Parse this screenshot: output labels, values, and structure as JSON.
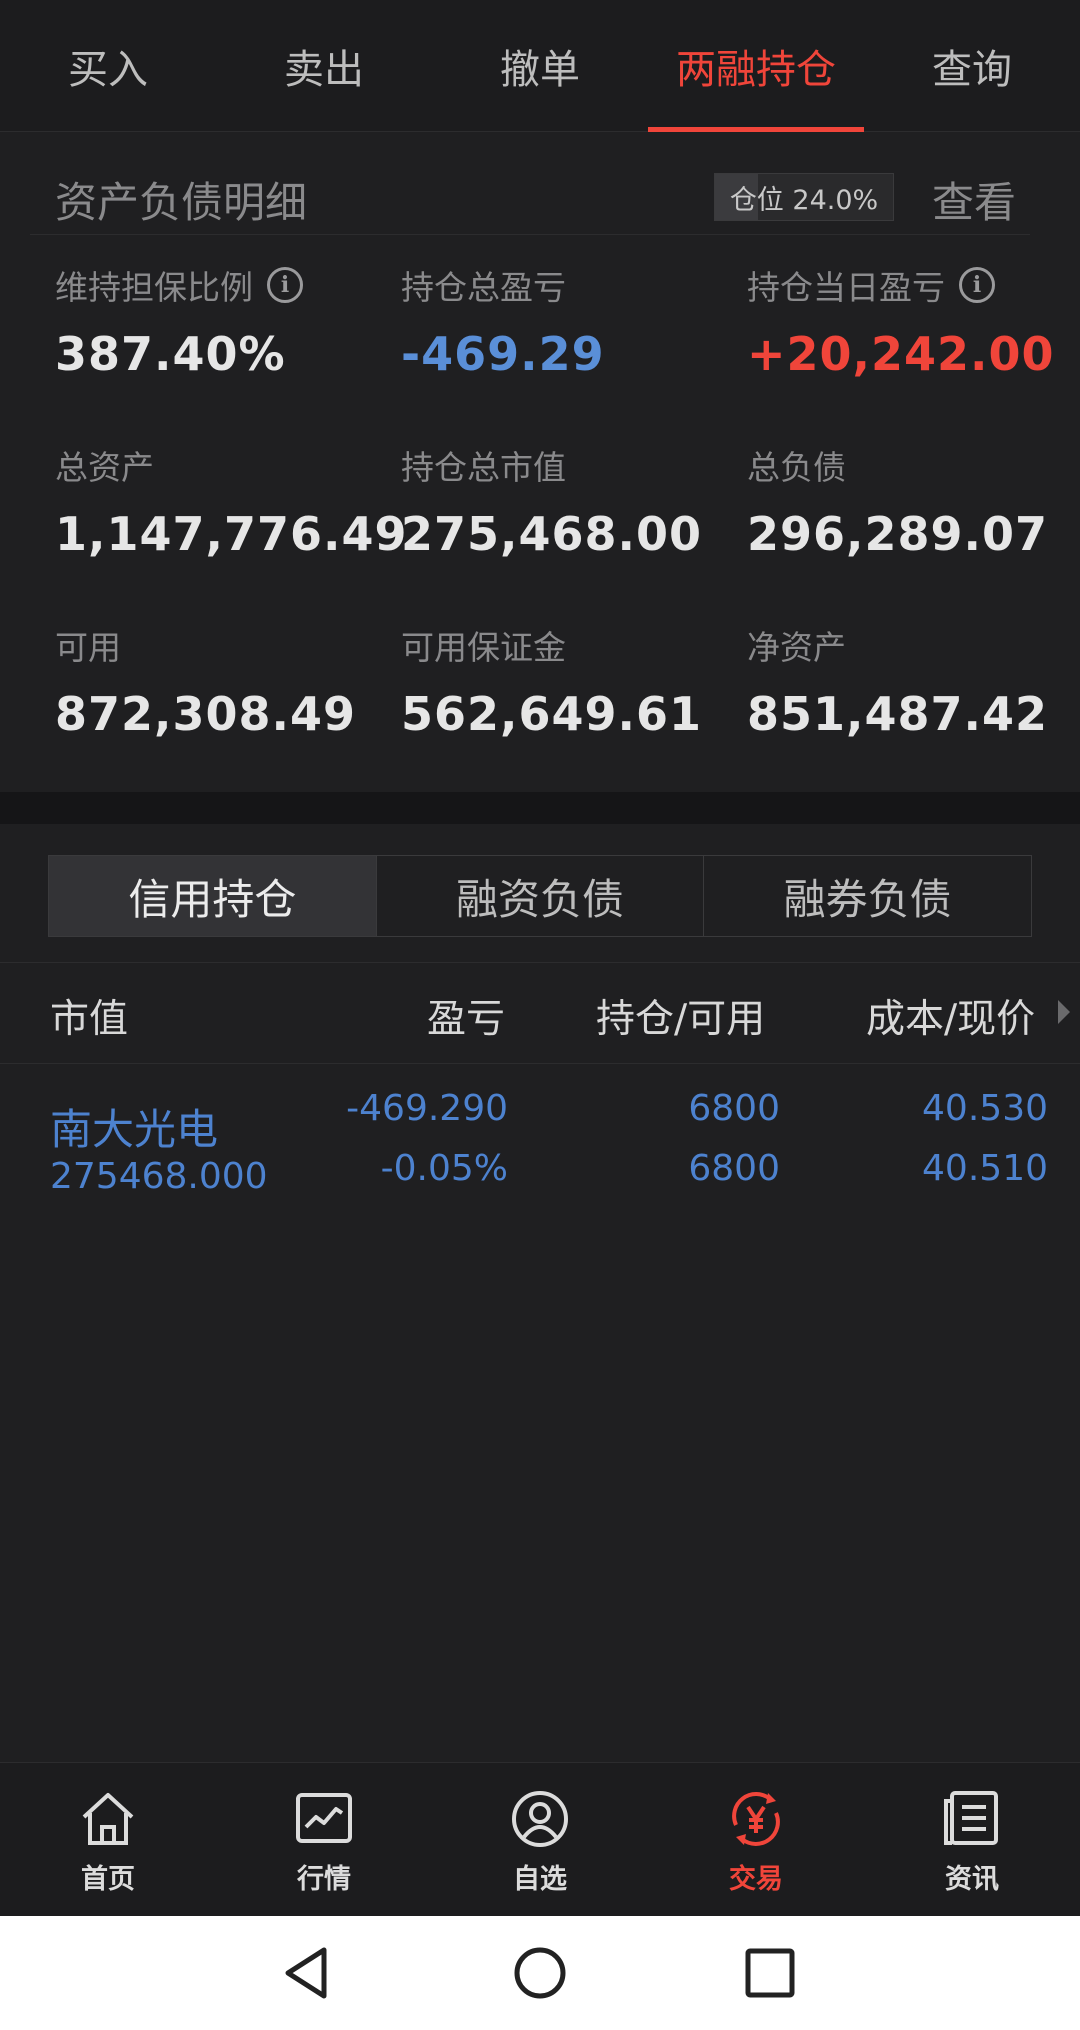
{
  "top_tabs": {
    "items": [
      {
        "label": "买入"
      },
      {
        "label": "卖出"
      },
      {
        "label": "撤单"
      },
      {
        "label": "两融持仓"
      },
      {
        "label": "查询"
      }
    ],
    "active_index": 3
  },
  "asset": {
    "title": "资产负债明细",
    "position_badge": "仓位 24.0%",
    "position_ratio": 0.24,
    "view_label": "查看",
    "metrics": [
      {
        "label": "维持担保比例",
        "value": "387.40%",
        "info": true
      },
      {
        "label": "持仓总盈亏",
        "value": "-469.29",
        "color": "#5a8fd8"
      },
      {
        "label": "持仓当日盈亏",
        "value": "+20,242.00",
        "color": "#f0453a",
        "info": true
      },
      {
        "label": "总资产",
        "value": "1,147,776.49"
      },
      {
        "label": "持仓总市值",
        "value": "275,468.00"
      },
      {
        "label": "总负债",
        "value": "296,289.07"
      },
      {
        "label": "可用",
        "value": "872,308.49"
      },
      {
        "label": "可用保证金",
        "value": "562,649.61"
      },
      {
        "label": "净资产",
        "value": "851,487.42"
      }
    ]
  },
  "segments": {
    "items": [
      {
        "label": "信用持仓"
      },
      {
        "label": "融资负债"
      },
      {
        "label": "融券负债"
      }
    ],
    "active_index": 0
  },
  "table": {
    "headers": {
      "market_value": "市值",
      "profit_loss": "盈亏",
      "position_available": "持仓/可用",
      "cost_price": "成本/现价"
    },
    "rows": [
      {
        "name": "南大光电",
        "market_value": "275468.000",
        "profit_loss": "-469.290",
        "profit_loss_pct": "-0.05%",
        "position": "6800",
        "available": "6800",
        "cost": "40.530",
        "price": "40.510"
      }
    ]
  },
  "bottom_nav": {
    "items": [
      {
        "label": "首页",
        "icon": "home-icon"
      },
      {
        "label": "行情",
        "icon": "chart-icon"
      },
      {
        "label": "自选",
        "icon": "person-icon"
      },
      {
        "label": "交易",
        "icon": "yen-refresh-icon"
      },
      {
        "label": "资讯",
        "icon": "news-icon"
      }
    ],
    "active_index": 3
  },
  "colors": {
    "accent_red": "#f0453a",
    "loss_blue": "#5a8fd8",
    "background": "#1f1f21"
  }
}
